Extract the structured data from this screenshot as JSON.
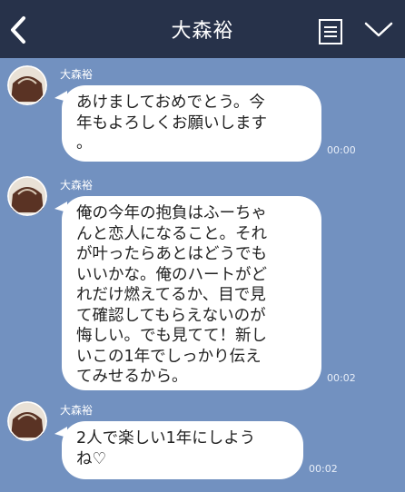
{
  "header": {
    "title": "大森裕"
  },
  "icons": {
    "back": "chevron-left-icon",
    "menu": "list-icon",
    "expand": "chevron-down-icon"
  },
  "messages": [
    {
      "sender": "大森裕",
      "text": "あけましておめでとう。今\n年もよろしくお願いします\n。",
      "time": "00:00"
    },
    {
      "sender": "大森裕",
      "text": "俺の今年の抱負はふーちゃ\nんと恋人になること。それ\nが叶ったらあとはどうでも\nいいかな。俺のハートがど\nれだけ燃えてるか、目で見\nて確認してもらえないのが\n悔しい。でも見てて！新し\nいこの1年でしっかり伝え\nてみせるから。",
      "time": "00:02"
    },
    {
      "sender": "大森裕",
      "text": "2人で楽しい1年にしよう\nね♡",
      "time": "00:02"
    }
  ],
  "colors": {
    "header_bg": "#27324a",
    "chat_bg": "#7291c0",
    "bubble_bg": "#ffffff"
  }
}
